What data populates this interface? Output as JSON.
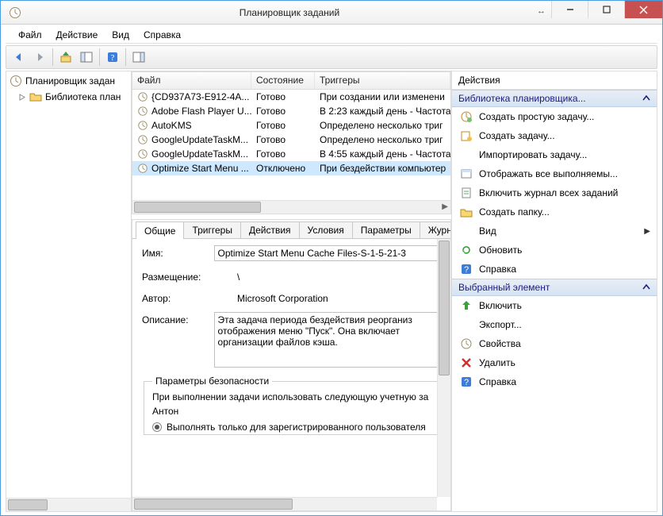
{
  "window": {
    "title": "Планировщик заданий"
  },
  "menu": {
    "file": "Файл",
    "action": "Действие",
    "view": "Вид",
    "help": "Справка"
  },
  "tree": {
    "root": "Планировщик задан",
    "child": "Библиотека план"
  },
  "table": {
    "headers": {
      "file": "Файл",
      "state": "Состояние",
      "triggers": "Триггеры"
    },
    "rows": [
      {
        "file": "{CD937A73-E912-4A...",
        "state": "Готово",
        "trigger": "При создании или изменени"
      },
      {
        "file": "Adobe Flash Player U...",
        "state": "Готово",
        "trigger": "В 2:23 каждый день - Частота"
      },
      {
        "file": "AutoKMS",
        "state": "Готово",
        "trigger": "Определено несколько триг"
      },
      {
        "file": "GoogleUpdateTaskM...",
        "state": "Готово",
        "trigger": "Определено несколько триг"
      },
      {
        "file": "GoogleUpdateTaskM...",
        "state": "Готово",
        "trigger": "В 4:55 каждый день - Частота"
      },
      {
        "file": "Optimize Start Menu ...",
        "state": "Отключено",
        "trigger": "При бездействии компьютер"
      }
    ]
  },
  "tabs": {
    "general": "Общие",
    "triggers": "Триггеры",
    "actions": "Действия",
    "conditions": "Условия",
    "params": "Параметры",
    "log": "Журн"
  },
  "details": {
    "name_lbl": "Имя:",
    "name_val": "Optimize Start Menu Cache Files-S-1-5-21-3",
    "location_lbl": "Размещение:",
    "location_val": "\\",
    "author_lbl": "Автор:",
    "author_val": "Microsoft Corporation",
    "desc_lbl": "Описание:",
    "desc_val": "Эта задача периода бездействия реорганиз отображения меню \"Пуск\". Она включает организации файлов кэша.",
    "sec_legend": "Параметры безопасности",
    "sec_line1": "При выполнении задачи использовать следующую учетную за",
    "sec_user": "Антон",
    "sec_radio": "Выполнять только для зарегистрированного пользователя"
  },
  "actions": {
    "title": "Действия",
    "group1": "Библиотека планировщика...",
    "g1": {
      "create_basic": "Создать простую задачу...",
      "create": "Создать задачу...",
      "import": "Импортировать задачу...",
      "show_running": "Отображать все выполняемы...",
      "enable_log": "Включить журнал всех заданий",
      "new_folder": "Создать папку...",
      "view": "Вид",
      "refresh": "Обновить",
      "help": "Справка"
    },
    "group2": "Выбранный элемент",
    "g2": {
      "enable": "Включить",
      "export": "Экспорт...",
      "properties": "Свойства",
      "delete": "Удалить",
      "help": "Справка"
    }
  },
  "colors": {
    "accent": "#1a1a7a"
  }
}
